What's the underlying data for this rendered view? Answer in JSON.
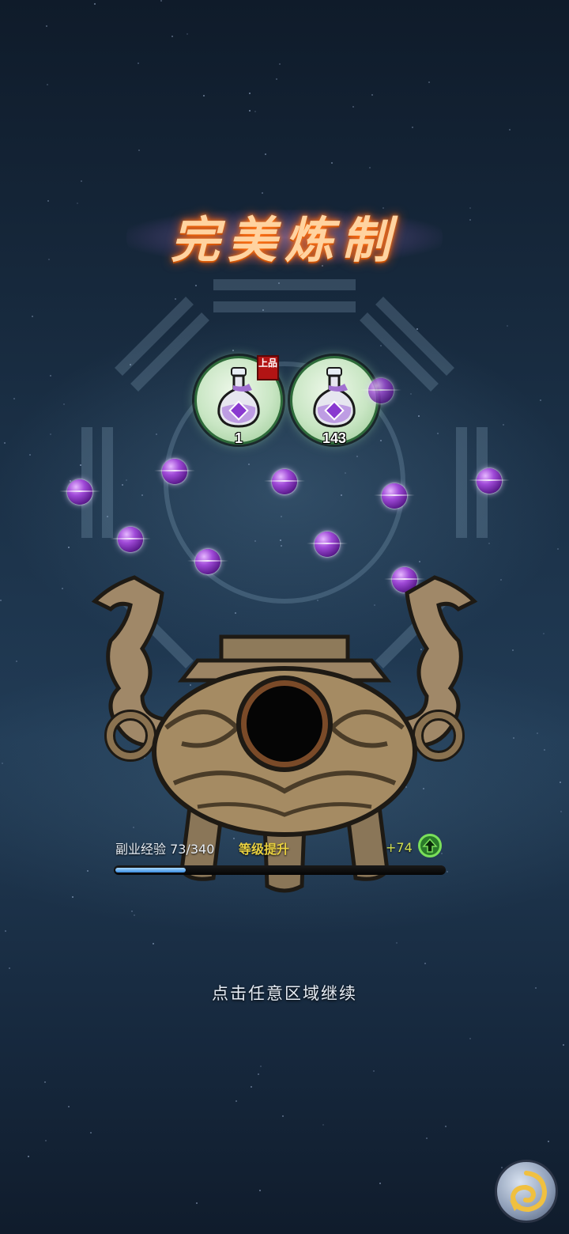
{
  "title": "完美炼制",
  "results": [
    {
      "icon": "purple-potion-bottle-icon",
      "count": "1",
      "quality_badge": "上品"
    },
    {
      "icon": "purple-potion-bottle-icon",
      "count": "143"
    }
  ],
  "experience": {
    "label": "副业经验 73/340",
    "current": 73,
    "max": 340,
    "level_up_text": "等级提升",
    "gain": "+74",
    "gain_icon": "level-up-arrow-icon"
  },
  "hint": "点击任意区域继续",
  "colors": {
    "accent": "#ffd3a0",
    "xp_bar": "#3b8ee0",
    "level_up": "#e8d040",
    "orb": "#a04ad8"
  }
}
